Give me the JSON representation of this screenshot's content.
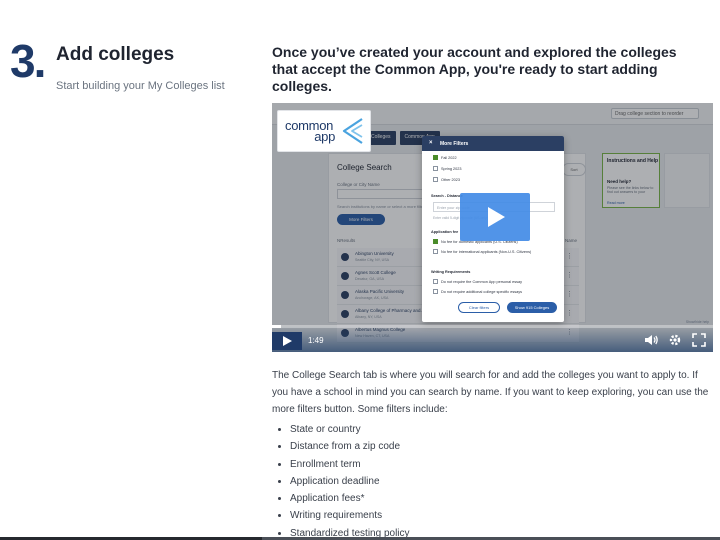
{
  "step": {
    "number": "3",
    "dot": ".",
    "title": "Add colleges",
    "subtitle": "Start building your My Colleges list"
  },
  "intro": "Once you’ve created your account and explored the colleges that accept the Common App, you're ready to start adding colleges.",
  "video": {
    "logo_line1": "common",
    "logo_line2": "app",
    "banner": "Drag college section to reorder",
    "nav_tabs": [
      "My Colleges",
      "Common App"
    ],
    "screen": {
      "title": "College Search",
      "field_label": "College or City Name",
      "field_hint": "Search institutions by name or select a more filters option",
      "filter_button": "More Filters",
      "results_label": "NResults",
      "sort_label": "Sort by Name",
      "sort_tab": "Sort",
      "rows": [
        {
          "name": "Abington University",
          "location": "Seattle City, NY, USA"
        },
        {
          "name": "Agnes Scott College",
          "location": "Decatur, GA, USA"
        },
        {
          "name": "Alaska Pacific University",
          "location": "Anchorage, AK, USA"
        },
        {
          "name": "Albany College of Pharmacy and...",
          "location": "Albany, NY, USA"
        },
        {
          "name": "Albertus Magnus College",
          "location": "New Haven, CT, USA"
        }
      ],
      "help_title": "Instructions and Help",
      "help_subtitle": "Need help?",
      "help_text": "Please see the links below to find out answers to your",
      "help_link": "Read more"
    },
    "modal": {
      "title": "More Filters",
      "close": "×",
      "term_options": [
        {
          "label": "Fall 2022",
          "checked": true
        },
        {
          "label": "Spring 2023",
          "checked": false
        },
        {
          "label": "Other 2023",
          "checked": false
        }
      ],
      "distance_label": "Search - Distance",
      "distance_placeholder": "Enter your zip code",
      "distance_hint": "Enter valid 5-digit zip code (US only)",
      "application_label": "Application fee",
      "application_options": [
        {
          "label": "No fee for domestic applicants (U.S. Citizens)",
          "checked": true
        },
        {
          "label": "No fee for international applicants (Non-U.S. Citizens)",
          "checked": false
        }
      ],
      "writing_label": "Writing Requirements",
      "writing_options": [
        {
          "label": "Do not require the Common App personal essay",
          "checked": false
        },
        {
          "label": "Do not require additional college specific essays",
          "checked": false
        }
      ],
      "clear_button": "Clear filters",
      "show_button": "Show 915 Colleges"
    },
    "time": "1:49",
    "progress": 0.02,
    "corner_note": "Show/hide help"
  },
  "body_text": "The College Search tab is where you will search for and add the colleges you want to apply to. If you have a school in mind you can search by name. If you want to keep exploring, you can use the more filters button. Some filters include:",
  "bullets": [
    "State or country",
    "Distance from a zip code",
    "Enrollment term",
    "Application deadline",
    "Application fees*",
    "Writing requirements",
    "Standardized testing policy"
  ],
  "icons": {
    "play": "play-icon",
    "volume": "volume-icon",
    "settings": "gear-icon",
    "fullscreen": "fullscreen-icon"
  },
  "colors": {
    "brand_navy": "#1f3a68",
    "player_blue": "#428be6",
    "help_green": "#7ab648"
  }
}
